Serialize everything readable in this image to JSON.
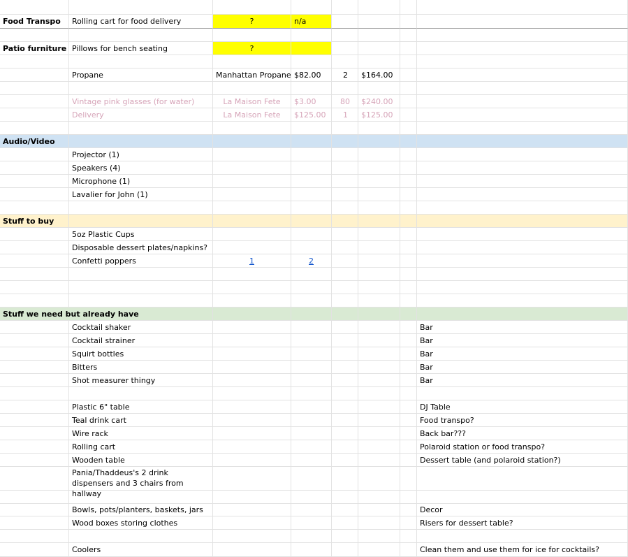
{
  "food": {
    "category": "Food Transpo",
    "item": "Rolling cart for food delivery",
    "price": "?",
    "qty": "n/a"
  },
  "patio": {
    "category": "Patio furniture",
    "item": "Pillows for bench seating",
    "price": "?"
  },
  "propane": {
    "item": "Propane",
    "vendor": "Manhattan Propane",
    "price": "$82.00",
    "qty": "2",
    "total": "$164.00"
  },
  "glasses": {
    "item": "Vintage pink glasses (for water)",
    "vendor": "La Maison Fete",
    "price": "$3.00",
    "qty": "80",
    "total": "$240.00"
  },
  "delivery": {
    "item": "Delivery",
    "vendor": "La Maison Fete",
    "price": "$125.00",
    "qty": "1",
    "total": "$125.00"
  },
  "audio": {
    "header": "Audio/Video",
    "items": [
      "Projector (1)",
      "Speakers (4)",
      "Microphone (1)",
      "Lavalier for John (1)"
    ]
  },
  "buy": {
    "header": "Stuff to buy",
    "items": [
      "5oz Plastic Cups",
      "Disposable dessert plates/napkins?",
      "Confetti poppers"
    ],
    "link1": "1",
    "link2": "2"
  },
  "have": {
    "header": "Stuff we need but already have",
    "items": [
      {
        "item": "Cocktail shaker",
        "note": "Bar"
      },
      {
        "item": "Cocktail strainer",
        "note": "Bar"
      },
      {
        "item": "Squirt bottles",
        "note": "Bar"
      },
      {
        "item": "Bitters",
        "note": "Bar"
      },
      {
        "item": "Shot measurer thingy",
        "note": "Bar"
      },
      {
        "item": "Plastic 6\" table",
        "note": "DJ Table"
      },
      {
        "item": "Teal drink cart",
        "note": "Food transpo?"
      },
      {
        "item": "Wire rack",
        "note": "Back bar???"
      },
      {
        "item": "Rolling cart",
        "note": "Polaroid station or food transpo?"
      },
      {
        "item": "Wooden table",
        "note": "Dessert table (and polaroid station?)"
      },
      {
        "item": "Pania/Thaddeus's 2 drink dispensers and 3 chairs from hallway",
        "note": ""
      },
      {
        "item": "Bowls, pots/planters, baskets, jars",
        "note": "Decor"
      },
      {
        "item": "Wood boxes storing clothes",
        "note": "Risers for dessert table?"
      },
      {
        "item": "Coolers",
        "note": "Clean them and use them for ice for cocktails?"
      }
    ]
  }
}
